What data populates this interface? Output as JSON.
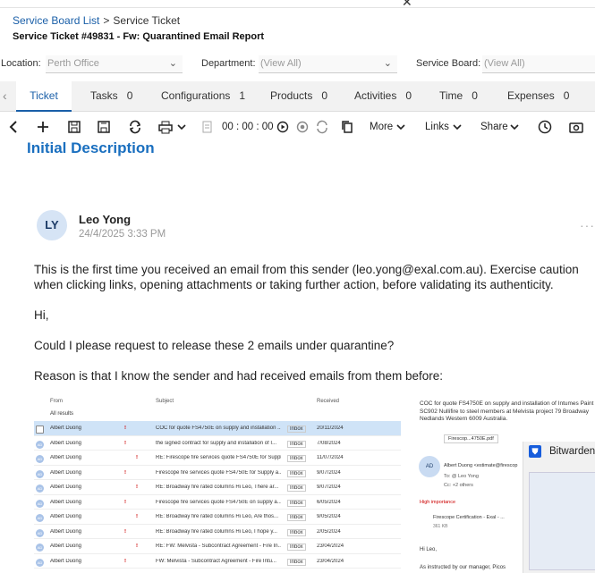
{
  "breadcrumb": {
    "parent": "Service Board List",
    "separator": ">",
    "current": "Service Ticket"
  },
  "ticket_title": "Service Ticket #49831 - Fw: Quarantined Email Report",
  "filters": {
    "location_label": "Location:",
    "location_value": "Perth Office",
    "department_label": "Department:",
    "department_value": "(View All)",
    "board_label": "Service Board:",
    "board_value": "(View All)"
  },
  "tabs": [
    {
      "label": "Ticket",
      "count": ""
    },
    {
      "label": "Tasks",
      "count": "0"
    },
    {
      "label": "Configurations",
      "count": "1"
    },
    {
      "label": "Products",
      "count": "0"
    },
    {
      "label": "Activities",
      "count": "0"
    },
    {
      "label": "Time",
      "count": "0"
    },
    {
      "label": "Expenses",
      "count": "0"
    }
  ],
  "toolbar": {
    "timer": "00 : 00 : 00",
    "more": "More",
    "links": "Links",
    "share": "Share"
  },
  "section_title": "Initial Description",
  "post": {
    "initials": "LY",
    "author": "Leo Yong",
    "date": "24/4/2025 3:33 PM",
    "warning_line1": "This is the first time you received an email from this sender (leo.yong@exal.com.au). Exercise caution",
    "warning_line2": "when clicking links, opening attachments or taking further action, before validating its authenticity.",
    "greeting": "Hi,",
    "request": "Could I please request to release these 2 emails under quarantine?",
    "reason": "Reason is that I know the sender and had received emails from them before:"
  },
  "email_list": {
    "headers": {
      "from": "From",
      "subject": "Subject",
      "received": "Received"
    },
    "group": "All results",
    "rows": [
      {
        "from": "Albert Duong",
        "subject": "COC for quote FS4750E on supply and installation ...",
        "folder": "Inbox",
        "received": "20/11/2024"
      },
      {
        "from": "Albert Duong",
        "subject": "the signed contract for supply and installation of I...",
        "folder": "Inbox",
        "received": "7/08/2024"
      },
      {
        "from": "Albert Duong",
        "subject": "RE: Firescope fire services quote FS4750E for Suppl...",
        "folder": "Inbox",
        "received": "11/07/2024"
      },
      {
        "from": "Albert Duong",
        "subject": "Firescope fire services quote FS4750E for Supply a...",
        "folder": "Inbox",
        "received": "9/07/2024"
      },
      {
        "from": "Albert Duong",
        "subject": "RE: Broadway fire rated columns   Hi Leo, There ar...",
        "folder": "Inbox",
        "received": "9/07/2024"
      },
      {
        "from": "Albert Duong",
        "subject": "Firescope fire services quote FS4750E on supply a...",
        "folder": "Inbox",
        "received": "6/05/2024"
      },
      {
        "from": "Albert Duong",
        "subject": "RE: Broadway fire rated columns   Hi Leo, Are thos...",
        "folder": "Inbox",
        "received": "9/05/2024"
      },
      {
        "from": "Albert Duong",
        "subject": "RE: Broadway fire rated columns   Hi Leo, I hope y...",
        "folder": "Inbox",
        "received": "2/05/2024"
      },
      {
        "from": "Albert Duong",
        "subject": "RE: FW: Melvista - Subcontract Agreement - Fire In...",
        "folder": "Inbox",
        "received": "23/04/2024"
      },
      {
        "from": "Albert Duong",
        "subject": "FW: Melvista - Subcontract Agreement - Fire Intu...",
        "folder": "Inbox",
        "received": "23/04/2024"
      }
    ]
  },
  "email_preview": {
    "subject": "COC for quote FS4750E on supply and installation of Intumes Paint SC902 Nullifire to steel members at Melvista project 79 Broadway Nedlands Western 6009 Australia.",
    "attachment": "Firescop...4750E.pdf",
    "sender": "Albert Duong <estimate@firescop",
    "to": "To: @ Leo Yong",
    "cc": "Cc: +2 others",
    "importance": "High importance",
    "file_name": "Firescope Certification - Exal - ...",
    "file_size": "361 KB",
    "greeting": "Hi Leo,",
    "body_start": "As instructed by our manager, Picos"
  },
  "bitwarden": {
    "label": "Bitwarden"
  }
}
